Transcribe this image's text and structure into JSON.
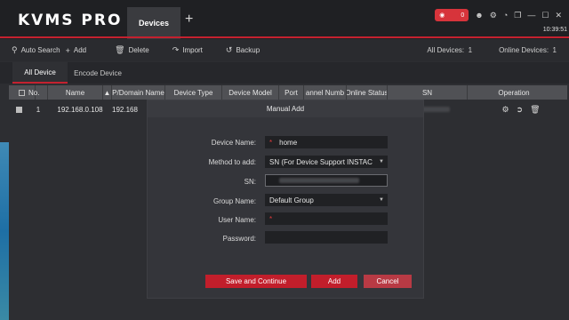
{
  "app": {
    "logo": "KVMS PRO",
    "tab_devices": "Devices",
    "tab_add": "+",
    "alarm_count": "0",
    "clock": "10:39:51"
  },
  "toolbar": {
    "auto_search": "Auto Search",
    "add": "Add",
    "delete": "Delete",
    "import": "Import",
    "backup": "Backup",
    "all_devices_label": "All Devices:",
    "all_devices_count": "1",
    "online_devices_label": "Online Devices:",
    "online_devices_count": "1"
  },
  "subtabs": {
    "all_device": "All Device",
    "encode_device": "Encode Device"
  },
  "table": {
    "columns": [
      "No.",
      "Name",
      "P/Domain Name",
      "Device Type",
      "Device Model",
      "Port",
      "annel Numb",
      "Online Status",
      "SN",
      "Operation"
    ],
    "row": {
      "no": "1",
      "name": "192.168.0.108",
      "ip": "192.168"
    }
  },
  "dialog": {
    "title": "Manual Add",
    "device_name_label": "Device Name:",
    "device_name_value": "home",
    "method_label": "Method to add:",
    "method_value": "SN (For Device Support INSTAC",
    "sn_label": "SN:",
    "group_label": "Group Name:",
    "group_value": "Default Group",
    "user_label": "User Name:",
    "password_label": "Password:",
    "save_continue": "Save and Continue",
    "add": "Add",
    "cancel": "Cancel"
  },
  "colors": {
    "accent": "#c4212f",
    "background": "#2d2e32"
  }
}
